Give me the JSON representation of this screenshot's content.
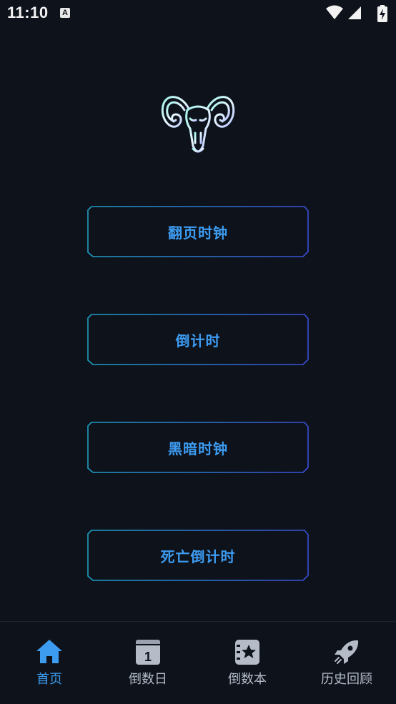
{
  "status_bar": {
    "time": "11:10",
    "notification_icon": "a-letter-icon",
    "icons": [
      "wifi-icon",
      "signal-icon",
      "battery-charging-icon"
    ]
  },
  "logo": {
    "icon": "ram-skull-icon"
  },
  "menu": {
    "buttons": [
      {
        "label": "翻页时钟"
      },
      {
        "label": "倒计时"
      },
      {
        "label": "黑暗时钟"
      },
      {
        "label": "死亡倒计时"
      }
    ]
  },
  "bottom_nav": {
    "items": [
      {
        "label": "首页",
        "icon": "home-icon",
        "active": true
      },
      {
        "label": "倒数日",
        "icon": "calendar-one-icon",
        "active": false
      },
      {
        "label": "倒数本",
        "icon": "star-notebook-icon",
        "active": false
      },
      {
        "label": "历史回顾",
        "icon": "rocket-icon",
        "active": false
      }
    ]
  },
  "colors": {
    "background": "#0d121b",
    "accent": "#3d9bf0",
    "button_border_start": "#1f9fc4",
    "button_border_end": "#3b4fd8",
    "nav_inactive": "#b5bcc8"
  }
}
